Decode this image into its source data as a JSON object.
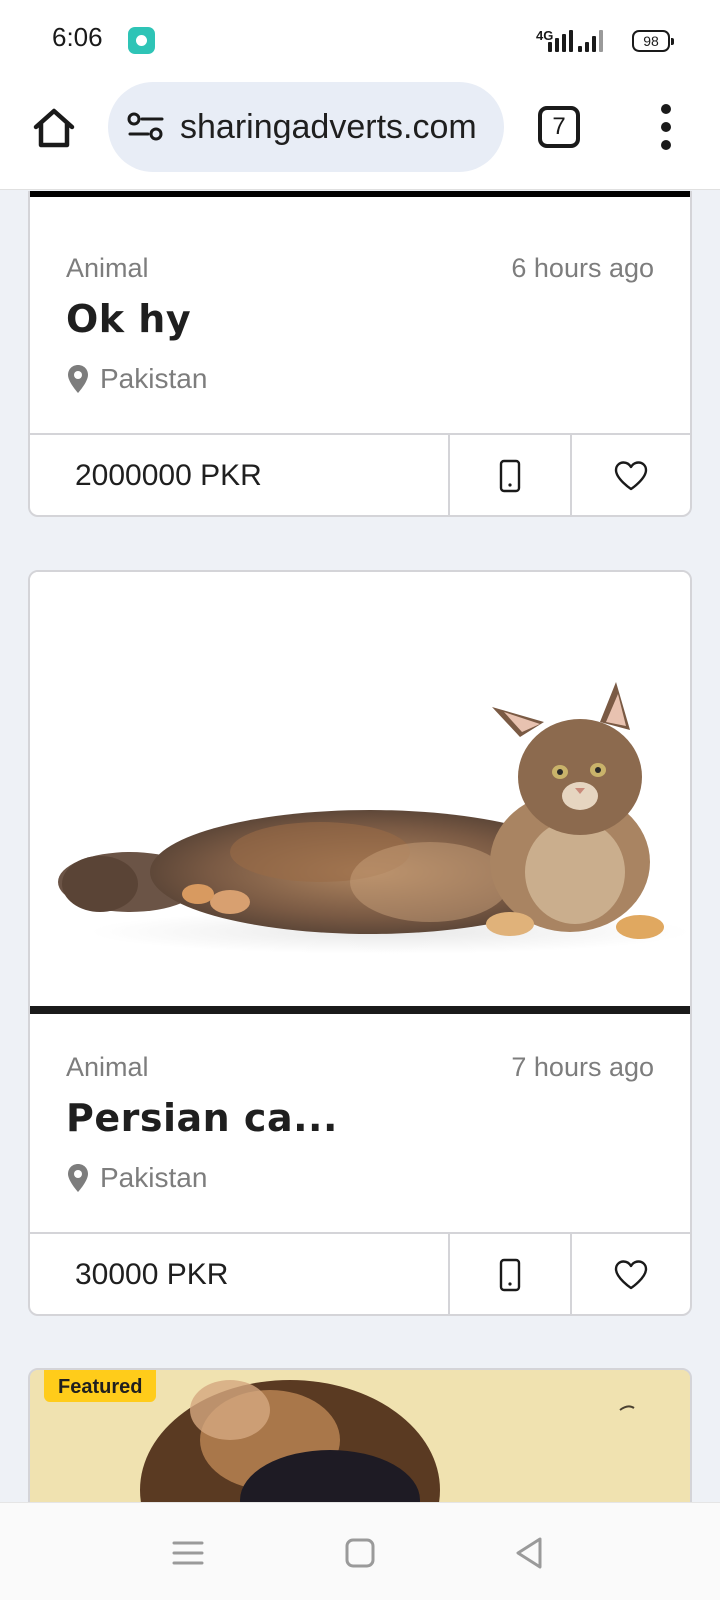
{
  "status_bar": {
    "time": "6:06",
    "network": "4G",
    "battery": "98",
    "icons": [
      "app-notification-icon",
      "signal-icon",
      "battery-icon"
    ]
  },
  "browser": {
    "url": "sharingadverts.com",
    "tab_count": "7",
    "icons": [
      "home-icon",
      "site-settings-icon",
      "tabs-icon",
      "more-menu-icon"
    ]
  },
  "listings": [
    {
      "category": "Animal",
      "time": "6 hours ago",
      "title": "Ok hy",
      "location": "Pakistan",
      "price": "2000000 PKR"
    },
    {
      "category": "Animal",
      "time": "7 hours ago",
      "title": "Persian ca...",
      "location": "Pakistan",
      "price": "30000 PKR",
      "image": "cat-photo"
    }
  ],
  "featured": {
    "badge": "Featured",
    "image": "dog-photo"
  },
  "nav_bar": {
    "icons": [
      "recents-icon",
      "home-nav-icon",
      "back-icon"
    ]
  },
  "colors": {
    "page_background": "#eef1f6",
    "featured_badge": "#ffcc1a",
    "url_pill": "#e8edf6"
  }
}
